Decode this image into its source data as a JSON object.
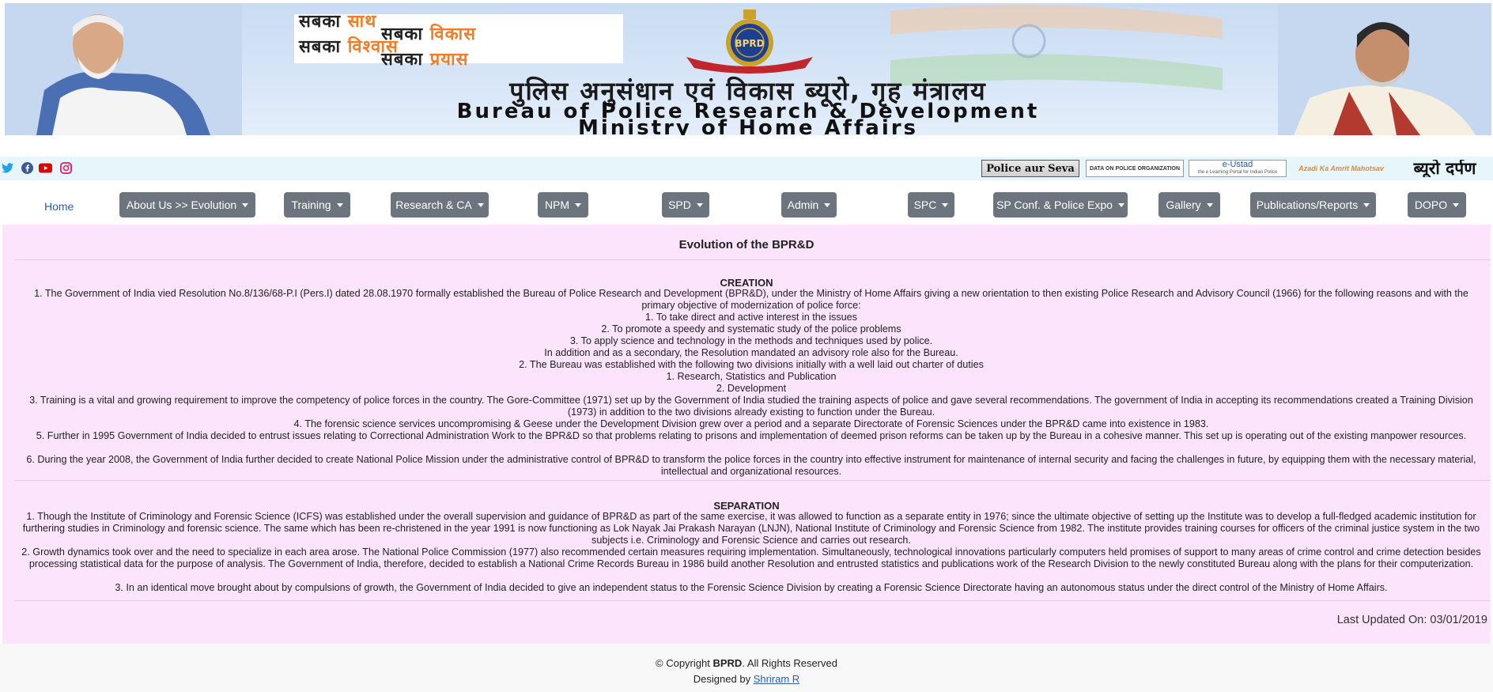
{
  "banner": {
    "slogan": [
      {
        "black": "सबका ",
        "orange": "साथ"
      },
      {
        "black": "सबका ",
        "orange": "विकास"
      },
      {
        "black": "सबका ",
        "orange": "विश्वास"
      },
      {
        "black": "सबका ",
        "orange": "प्रयास"
      }
    ],
    "emblem_text": "BPRD",
    "title_hindi": "पुलिस अनुसंधान एवं विकास ब्यूरो, गृह मंत्रालय",
    "title_english_line1": "Bureau of Police Research & Development",
    "title_english_line2": "Ministry of Home Affairs"
  },
  "social": {
    "icons": [
      "twitter-icon",
      "facebook-icon",
      "youtube-icon",
      "instagram-icon"
    ],
    "colors": {
      "twitter": "#1da1f2",
      "facebook": "#3b5998",
      "youtube": "#e00000",
      "instagram": "#d62976"
    }
  },
  "partners": {
    "p1": "Police aur Seva",
    "p2": "DATA ON POLICE ORGANIZATION",
    "p3_title": "e-Ustad",
    "p3_sub": "the e Learning Portal for Indian Police",
    "p4": "Azadi Ka Amrit Mahotsav",
    "p5": "ब्यूरो दर्पण"
  },
  "nav": {
    "home": "Home",
    "items": [
      "About Us >> Evolution",
      "Training",
      "Research & CA",
      "NPM",
      "SPD",
      "Admin",
      "SPC",
      "SP Conf. & Police Expo",
      "Gallery",
      "Publications/Reports",
      "DOPO"
    ]
  },
  "content": {
    "title": "Evolution of the BPR&D",
    "creation_heading": "CREATION",
    "creation": [
      "1. The Government of India vied Resolution No.8/136/68-P.I (Pers.I) dated 28.08.1970 formally established the Bureau of Police Research and Development (BPR&D), under the Ministry of Home Affairs giving a new orientation to then existing Police Research and Advisory Council (1966) for the following reasons and with the primary objective of modernization of police force:",
      "1. To take direct and active interest in the issues",
      "2. To promote a speedy and systematic study of the police problems",
      "3. To apply science and technology in the methods and techniques used by police.",
      "In addition and as a secondary, the Resolution mandated an advisory role also for the Bureau.",
      "2. The Bureau was established with the following two divisions initially with a well laid out charter of duties",
      "1. Research, Statistics and Publication",
      "2. Development",
      "3. Training is a vital and growing requirement to improve the competency of police forces in the country. The Gore-Committee (1971) set up by the Government of India studied the training aspects of police and gave several recommendations. The government of India in accepting its recommendations created a Training Division (1973) in addition to the two divisions already existing to function under the Bureau.",
      "4. The forensic science services uncompromising & Geese under the Development Division grew over a period and a separate Directorate of Forensic Sciences under the BPR&D came into existence in 1983.",
      "5. Further in 1995 Government of India decided to entrust issues relating to Correctional Administration Work to the BPR&D so that problems relating to prisons and implementation of deemed prison reforms can be taken up by the Bureau in a cohesive manner. This set up is operating out of the existing manpower resources.",
      "6. During the year 2008, the Government of India further decided to create National Police Mission under the administrative control of BPR&D to transform the police forces in the country into effective instrument for maintenance of internal security and facing the challenges in future, by equipping them with the necessary material, intellectual and organizational resources."
    ],
    "separation_heading": "SEPARATION",
    "separation": [
      "1. Though the Institute of Criminology and Forensic Science (ICFS) was established under the overall supervision and guidance of BPR&D as part of the same exercise, it was allowed to function as a separate entity in 1976; since the ultimate objective of setting up the Institute was to develop a full-fledged academic institution for furthering studies in Criminology and forensic science. The same which has been re-christened in the year 1991 is now functioning as Lok Nayak Jai Prakash Narayan (LNJN), National Institute of Criminology and Forensic Science from 1982. The institute provides training courses for officers of the criminal justice system in the two subjects i.e. Criminology and Forensic Science and carries out research.",
      "2. Growth dynamics took over and the need to specialize in each area arose. The National Police Commission (1977) also recommended certain measures requiring implementation. Simultaneously, technological innovations particularly computers held promises of support to many areas of crime control and crime detection besides processing statistical data for the purpose of analysis. The Government of India, therefore, decided to establish a National Crime Records Bureau in 1986 build another Resolution and entrusted statistics and publications work of the Research Division to the newly constituted Bureau along with the plans for their computerization.",
      "3. In an identical move brought about by compulsions of growth, the Government of India decided to give an independent status to the Forensic Science Division by creating a Forensic Science Directorate having an autonomous status under the direct control of the Ministry of Home Affairs."
    ],
    "last_updated": "Last Updated On: 03/01/2019"
  },
  "footer": {
    "copyright_prefix": "© Copyright ",
    "copyright_brand": "BPRD",
    "copyright_suffix": ". All Rights Reserved",
    "designed_prefix": "Designed by ",
    "designer": "Shriram R"
  },
  "colors": {
    "content_bg": "#fce4fc",
    "nav_button": "#6c757d",
    "link": "#2a5fa8",
    "strip_bg": "#e7f6fb"
  }
}
